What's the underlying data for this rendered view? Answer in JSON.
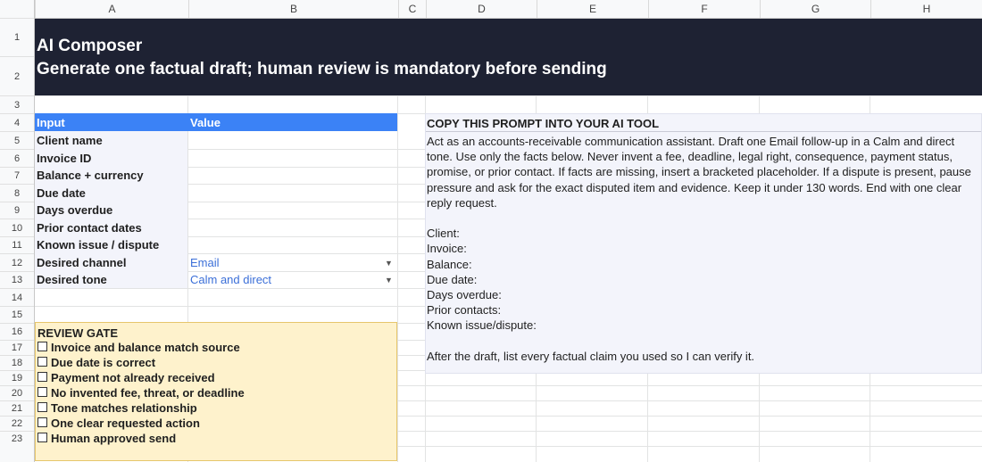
{
  "columns": [
    "A",
    "B",
    "C",
    "D",
    "E",
    "F",
    "G",
    "H"
  ],
  "rows": [
    "1",
    "2",
    "3",
    "4",
    "5",
    "6",
    "7",
    "8",
    "9",
    "10",
    "11",
    "12",
    "13",
    "14",
    "15",
    "16",
    "17",
    "18",
    "19",
    "20",
    "21",
    "22",
    "23"
  ],
  "banner": {
    "title": "AI Composer",
    "subtitle": "Generate one factual draft; human review is mandatory before sending"
  },
  "inputs": {
    "header_input": "Input",
    "header_value": "Value",
    "items": [
      {
        "label": "Client name",
        "value": ""
      },
      {
        "label": "Invoice ID",
        "value": ""
      },
      {
        "label": "Balance + currency",
        "value": ""
      },
      {
        "label": "Due date",
        "value": ""
      },
      {
        "label": "Days overdue",
        "value": ""
      },
      {
        "label": "Prior contact dates",
        "value": ""
      },
      {
        "label": "Known issue / dispute",
        "value": ""
      },
      {
        "label": "Desired channel",
        "value": "Email"
      },
      {
        "label": "Desired tone",
        "value": "Calm and direct"
      }
    ]
  },
  "review_gate": {
    "title": "REVIEW GATE",
    "items": [
      "Invoice and balance match source",
      "Due date is correct",
      "Payment not already received",
      "No invented fee, threat, or deadline",
      "Tone matches relationship",
      "One clear requested action",
      "Human approved send"
    ]
  },
  "prompt_panel": {
    "title": "COPY THIS PROMPT INTO YOUR AI TOOL",
    "body": "Act as an accounts-receivable communication assistant. Draft one Email follow-up in a Calm and direct tone. Use only the facts below. Never invent a fee, deadline, legal right, consequence, payment status, promise, or prior contact. If facts are missing, insert a bracketed placeholder. If a dispute is present, pause pressure and ask for the exact disputed item and evidence. Keep it under 130 words. End with one clear reply request.\n\nClient:\nInvoice:\nBalance:\nDue date:\nDays overdue:\nPrior contacts:\nKnown issue/dispute:\n\nAfter the draft, list every factual claim you used so I can verify it."
  },
  "colors": {
    "banner_bg": "#1e2233",
    "header_blue": "#3b82f6",
    "review_bg": "#fef2cc",
    "value_text": "#3b6fd8"
  }
}
